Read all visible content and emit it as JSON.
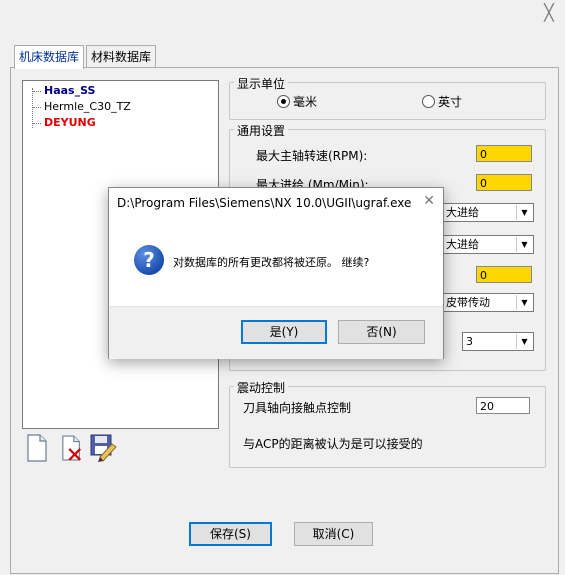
{
  "window": {
    "close_glyph": "╳"
  },
  "tabs": [
    {
      "label": "机床数据库",
      "active": true
    },
    {
      "label": "材料数据库",
      "active": false
    }
  ],
  "machine_list": [
    {
      "name": "Haas_SS",
      "style": "blue"
    },
    {
      "name": "Hermle_C30_TZ",
      "style": "normal"
    },
    {
      "name": "DEYUNG",
      "style": "red"
    }
  ],
  "display_units": {
    "title": "显示单位",
    "options": [
      {
        "label": "毫米",
        "checked": true
      },
      {
        "label": "英寸",
        "checked": false
      }
    ]
  },
  "general": {
    "title": "通用设置",
    "max_spindle_label": "最大主轴转速(RPM):",
    "max_spindle_value": "0",
    "max_feed_label": "最大进给 (Mm/Min):",
    "max_feed_value": "0",
    "select1_value": "大进给",
    "select2_value": "大进给",
    "input3_value": "0",
    "select3_value": "皮带传动",
    "select4_value": "3"
  },
  "vibration": {
    "title": "震动控制",
    "contact_label": "刀具轴向接触点控制",
    "contact_value": "20",
    "acp_label": "与ACP的距离被认为是可以接受的"
  },
  "footer": {
    "save_label": "保存(S)",
    "cancel_label": "取消(C)"
  },
  "modal": {
    "title": "D:\\Program Files\\Siemens\\NX 10.0\\UGII\\ugraf.exe",
    "message": "对数据库的所有更改都将被还原。 继续?",
    "yes_label": "是(Y)",
    "no_label": "否(N)",
    "close_glyph": "✕",
    "icon_glyph": "?"
  },
  "colors": {
    "highlight_input": "#ffd700",
    "tab_active_text": "#003399",
    "machine_blue": "#000080",
    "machine_red": "#e00000",
    "default_button_border": "#0078d7"
  }
}
